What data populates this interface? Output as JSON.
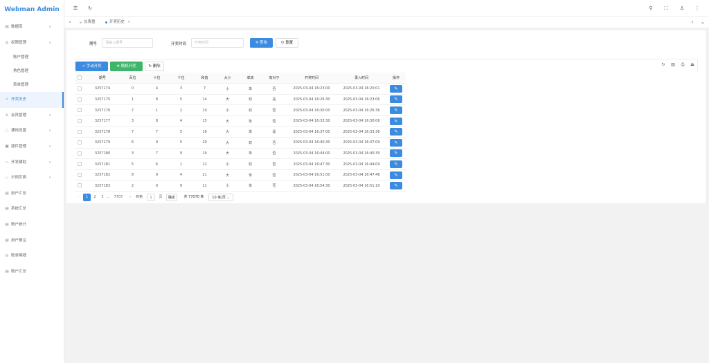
{
  "app": {
    "title": "Webman Admin"
  },
  "sidebar": {
    "items": [
      {
        "label": "数据库",
        "icon": "database-icon",
        "glyph": "▤",
        "chevron": "∨"
      },
      {
        "label": "权限管理",
        "icon": "shield-icon",
        "glyph": "◎",
        "chevron": "∧"
      },
      {
        "label": "账户管理",
        "sub": true
      },
      {
        "label": "角色管理",
        "sub": true
      },
      {
        "label": "菜单管理",
        "sub": true
      },
      {
        "label": "开奖历史",
        "icon": "history-icon",
        "glyph": "✧",
        "active": true
      },
      {
        "label": "会员管理",
        "icon": "user-icon",
        "glyph": "♙",
        "chevron": "∨"
      },
      {
        "label": "通用设置",
        "icon": "settings-icon",
        "glyph": "◌",
        "chevron": "∨"
      },
      {
        "label": "插件管理",
        "icon": "plugin-icon",
        "glyph": "▣",
        "chevron": "∨"
      },
      {
        "label": "开发辅助",
        "icon": "code-icon",
        "glyph": "‹›",
        "chevron": "∨"
      },
      {
        "label": "示例页面",
        "icon": "example-icon",
        "glyph": "◌",
        "chevron": "∨"
      },
      {
        "label": "用户汇总",
        "icon": "summary-icon",
        "glyph": "▤"
      },
      {
        "label": "系统汇总",
        "icon": "system-summary-icon",
        "glyph": "▤"
      },
      {
        "label": "账户统计",
        "icon": "stats-icon",
        "glyph": "▤"
      },
      {
        "label": "用户报注",
        "icon": "report-icon",
        "glyph": "▤"
      },
      {
        "label": "账单明细",
        "icon": "bill-icon",
        "glyph": "◎"
      },
      {
        "label": "账户汇总",
        "icon": "account-summary-icon",
        "glyph": "▤"
      }
    ]
  },
  "tabs": [
    {
      "label": "仪表盘",
      "active": false
    },
    {
      "label": "开奖历史",
      "active": true,
      "close": "×"
    }
  ],
  "search": {
    "issue_label": "期号",
    "issue_placeholder": "请输入期号",
    "time_label": "开奖时间",
    "time_placeholder": "开奖时间",
    "query_label": "查询",
    "reset_label": "重置"
  },
  "toolbar": {
    "manual_label": "手动开奖",
    "random_label": "随机开奖",
    "delete_label": "删除"
  },
  "table": {
    "headers": [
      "期号",
      "百位",
      "十位",
      "个位",
      "和值",
      "大小",
      "单双",
      "有对子",
      "开奖时间",
      "录入时间",
      "操作"
    ],
    "rows": [
      [
        "3257174",
        "0",
        "4",
        "3",
        "7",
        "小",
        "单",
        "否",
        "2025-03-04 16:23:00",
        "2025-03-04 16:20:01"
      ],
      [
        "3257175",
        "1",
        "8",
        "5",
        "14",
        "大",
        "双",
        "是",
        "2025-03-04 16:26:30",
        "2025-03-04 16:23:06"
      ],
      [
        "3257176",
        "7",
        "1",
        "2",
        "10",
        "小",
        "双",
        "否",
        "2025-03-04 16:30:00",
        "2025-03-04 16:26:36"
      ],
      [
        "3257177",
        "3",
        "8",
        "4",
        "15",
        "大",
        "单",
        "否",
        "2025-03-04 16:33:30",
        "2025-03-04 16:30:06"
      ],
      [
        "3257178",
        "7",
        "7",
        "5",
        "19",
        "大",
        "单",
        "是",
        "2025-03-04 16:37:00",
        "2025-03-04 16:33:36"
      ],
      [
        "3257179",
        "6",
        "9",
        "5",
        "20",
        "大",
        "双",
        "否",
        "2025-03-04 16:40:30",
        "2025-03-04 16:37:09"
      ],
      [
        "3257180",
        "3",
        "7",
        "9",
        "19",
        "大",
        "单",
        "否",
        "2025-03-04 16:44:00",
        "2025-03-04 16:40:39"
      ],
      [
        "3257181",
        "5",
        "6",
        "1",
        "12",
        "小",
        "双",
        "否",
        "2025-03-04 16:47:30",
        "2025-03-04 16:44:09"
      ],
      [
        "3257182",
        "8",
        "9",
        "4",
        "21",
        "大",
        "单",
        "否",
        "2025-03-04 16:51:00",
        "2025-03-04 16:47:48"
      ],
      [
        "3257183",
        "2",
        "0",
        "9",
        "11",
        "小",
        "单",
        "否",
        "2025-03-04 16:54:30",
        "2025-03-04 16:51:10"
      ]
    ]
  },
  "pagination": {
    "prev": "‹",
    "pages": [
      "1",
      "2",
      "3"
    ],
    "ellipsis": "…",
    "last_page": "7707",
    "next": "›",
    "goto_label": "到第",
    "goto_value": "1",
    "page_suffix": "页",
    "confirm": "确定",
    "total": "共 77070 条",
    "page_size": "10 条/页"
  }
}
